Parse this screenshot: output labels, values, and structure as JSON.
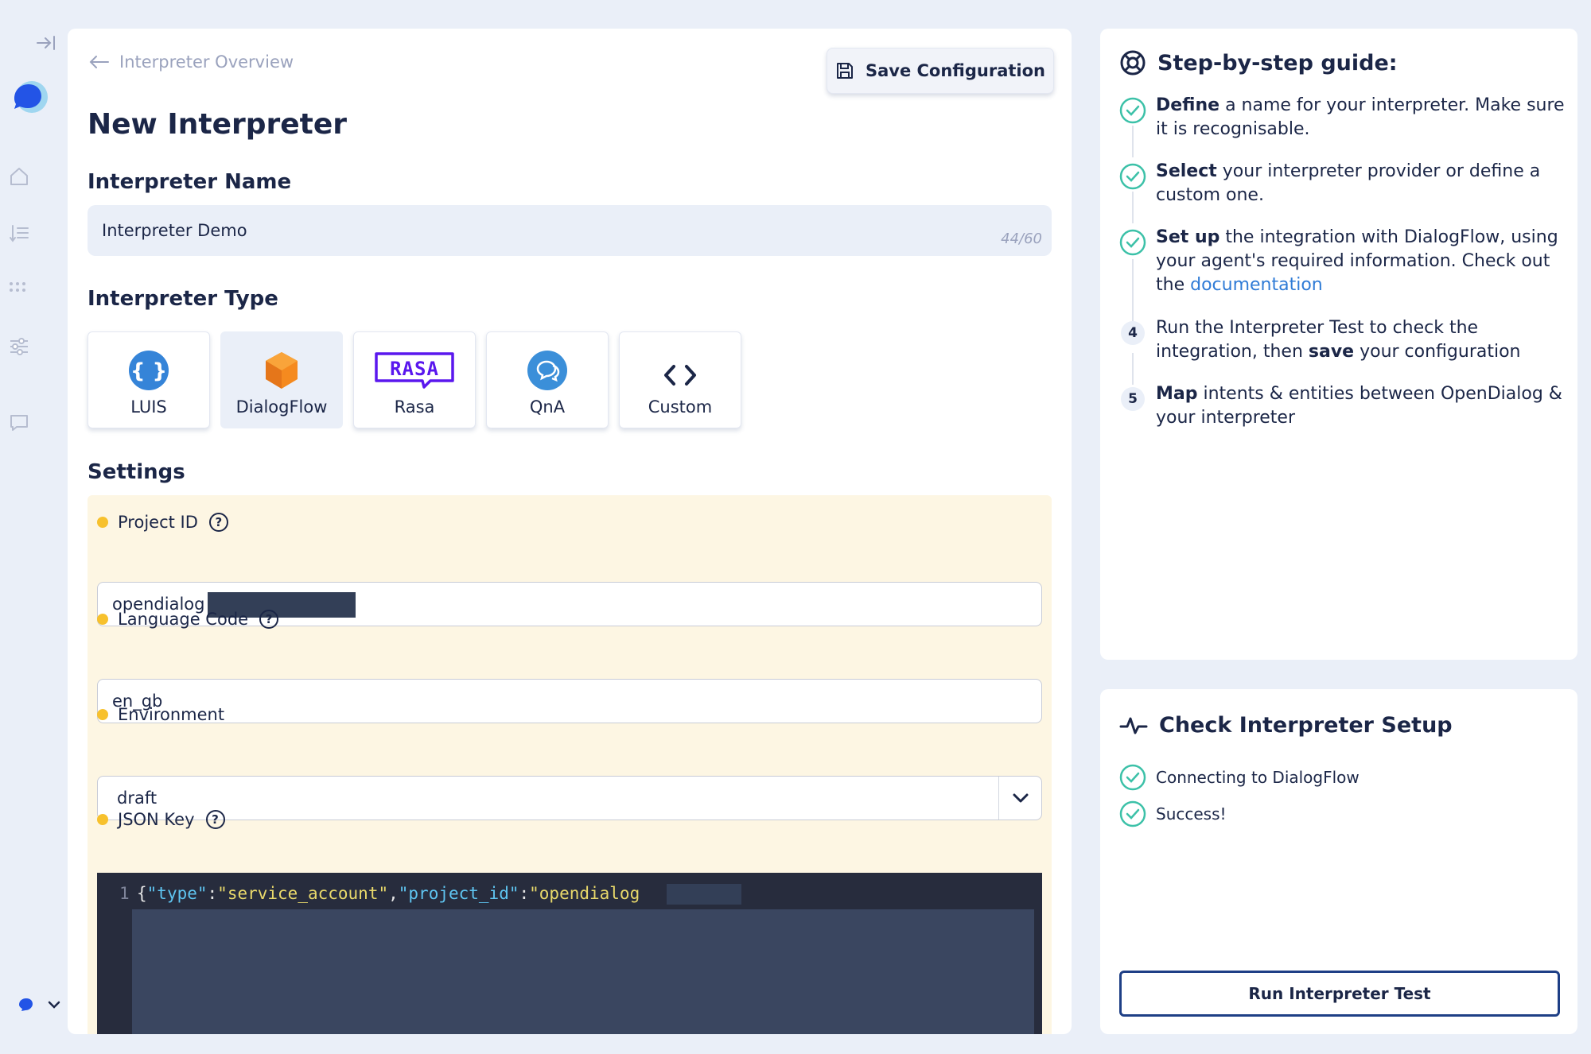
{
  "back_link": "Interpreter Overview",
  "save_button": "Save Configuration",
  "page_title": "New Interpreter",
  "name_section": {
    "title": "Interpreter Name",
    "value": "Interpreter Demo",
    "counter": "44/60"
  },
  "type_section": {
    "title": "Interpreter Type",
    "options": [
      {
        "label": "LUIS",
        "icon": "braces-icon",
        "selected": false
      },
      {
        "label": "DialogFlow",
        "icon": "dialogflow-cube-icon",
        "selected": true
      },
      {
        "label": "Rasa",
        "icon": "rasa-logo-icon",
        "selected": false
      },
      {
        "label": "QnA",
        "icon": "qna-chat-icon",
        "selected": false
      },
      {
        "label": "Custom",
        "icon": "code-brackets-icon",
        "selected": false
      }
    ]
  },
  "settings": {
    "title": "Settings",
    "project_id": {
      "label": "Project ID",
      "value": "opendialog"
    },
    "language_code": {
      "label": "Language Code",
      "value": "en_gb"
    },
    "environment": {
      "label": "Environment",
      "value": "draft"
    },
    "json_key": {
      "label": "JSON Key",
      "line_number": "1",
      "code": {
        "open": "{",
        "k1": "\"type\"",
        "colon1": ":",
        "v1": "\"service_account\"",
        "comma": ",",
        "k2": "\"project_id\"",
        "colon2": ":",
        "v2": "\"opendialog",
        "tail": "-"
      }
    }
  },
  "guide": {
    "title": "Step-by-step guide:",
    "steps": [
      {
        "status": "done",
        "bold": "Define",
        "text": " a name for your interpreter. Make sure it is recognisable."
      },
      {
        "status": "done",
        "bold": "Select",
        "text": " your interpreter provider or define a custom one."
      },
      {
        "status": "done",
        "bold": "Set up",
        "text": " the integration with DialogFlow, using your agent's required information. Check out the ",
        "link": "documentation"
      },
      {
        "status": "pending",
        "number": "4",
        "pre": "Run the Interpreter Test to check the integration, then ",
        "bold": "save",
        "text": " your configuration"
      },
      {
        "status": "pending",
        "number": "5",
        "bold": "Map",
        "text": " intents & entities between OpenDialog & your interpreter"
      }
    ]
  },
  "check": {
    "title": "Check Interpreter Setup",
    "items": [
      "Connecting to DialogFlow",
      "Success!"
    ],
    "run_button": "Run Interpreter Test"
  },
  "colors": {
    "background": "#eaeff8",
    "text": "#1b2647",
    "check_green": "#3cc1a8",
    "settings_bg": "#fdf6e3",
    "required_dot": "#f7c12d",
    "link": "#2f7bd6",
    "button_border": "#1e3f86"
  }
}
